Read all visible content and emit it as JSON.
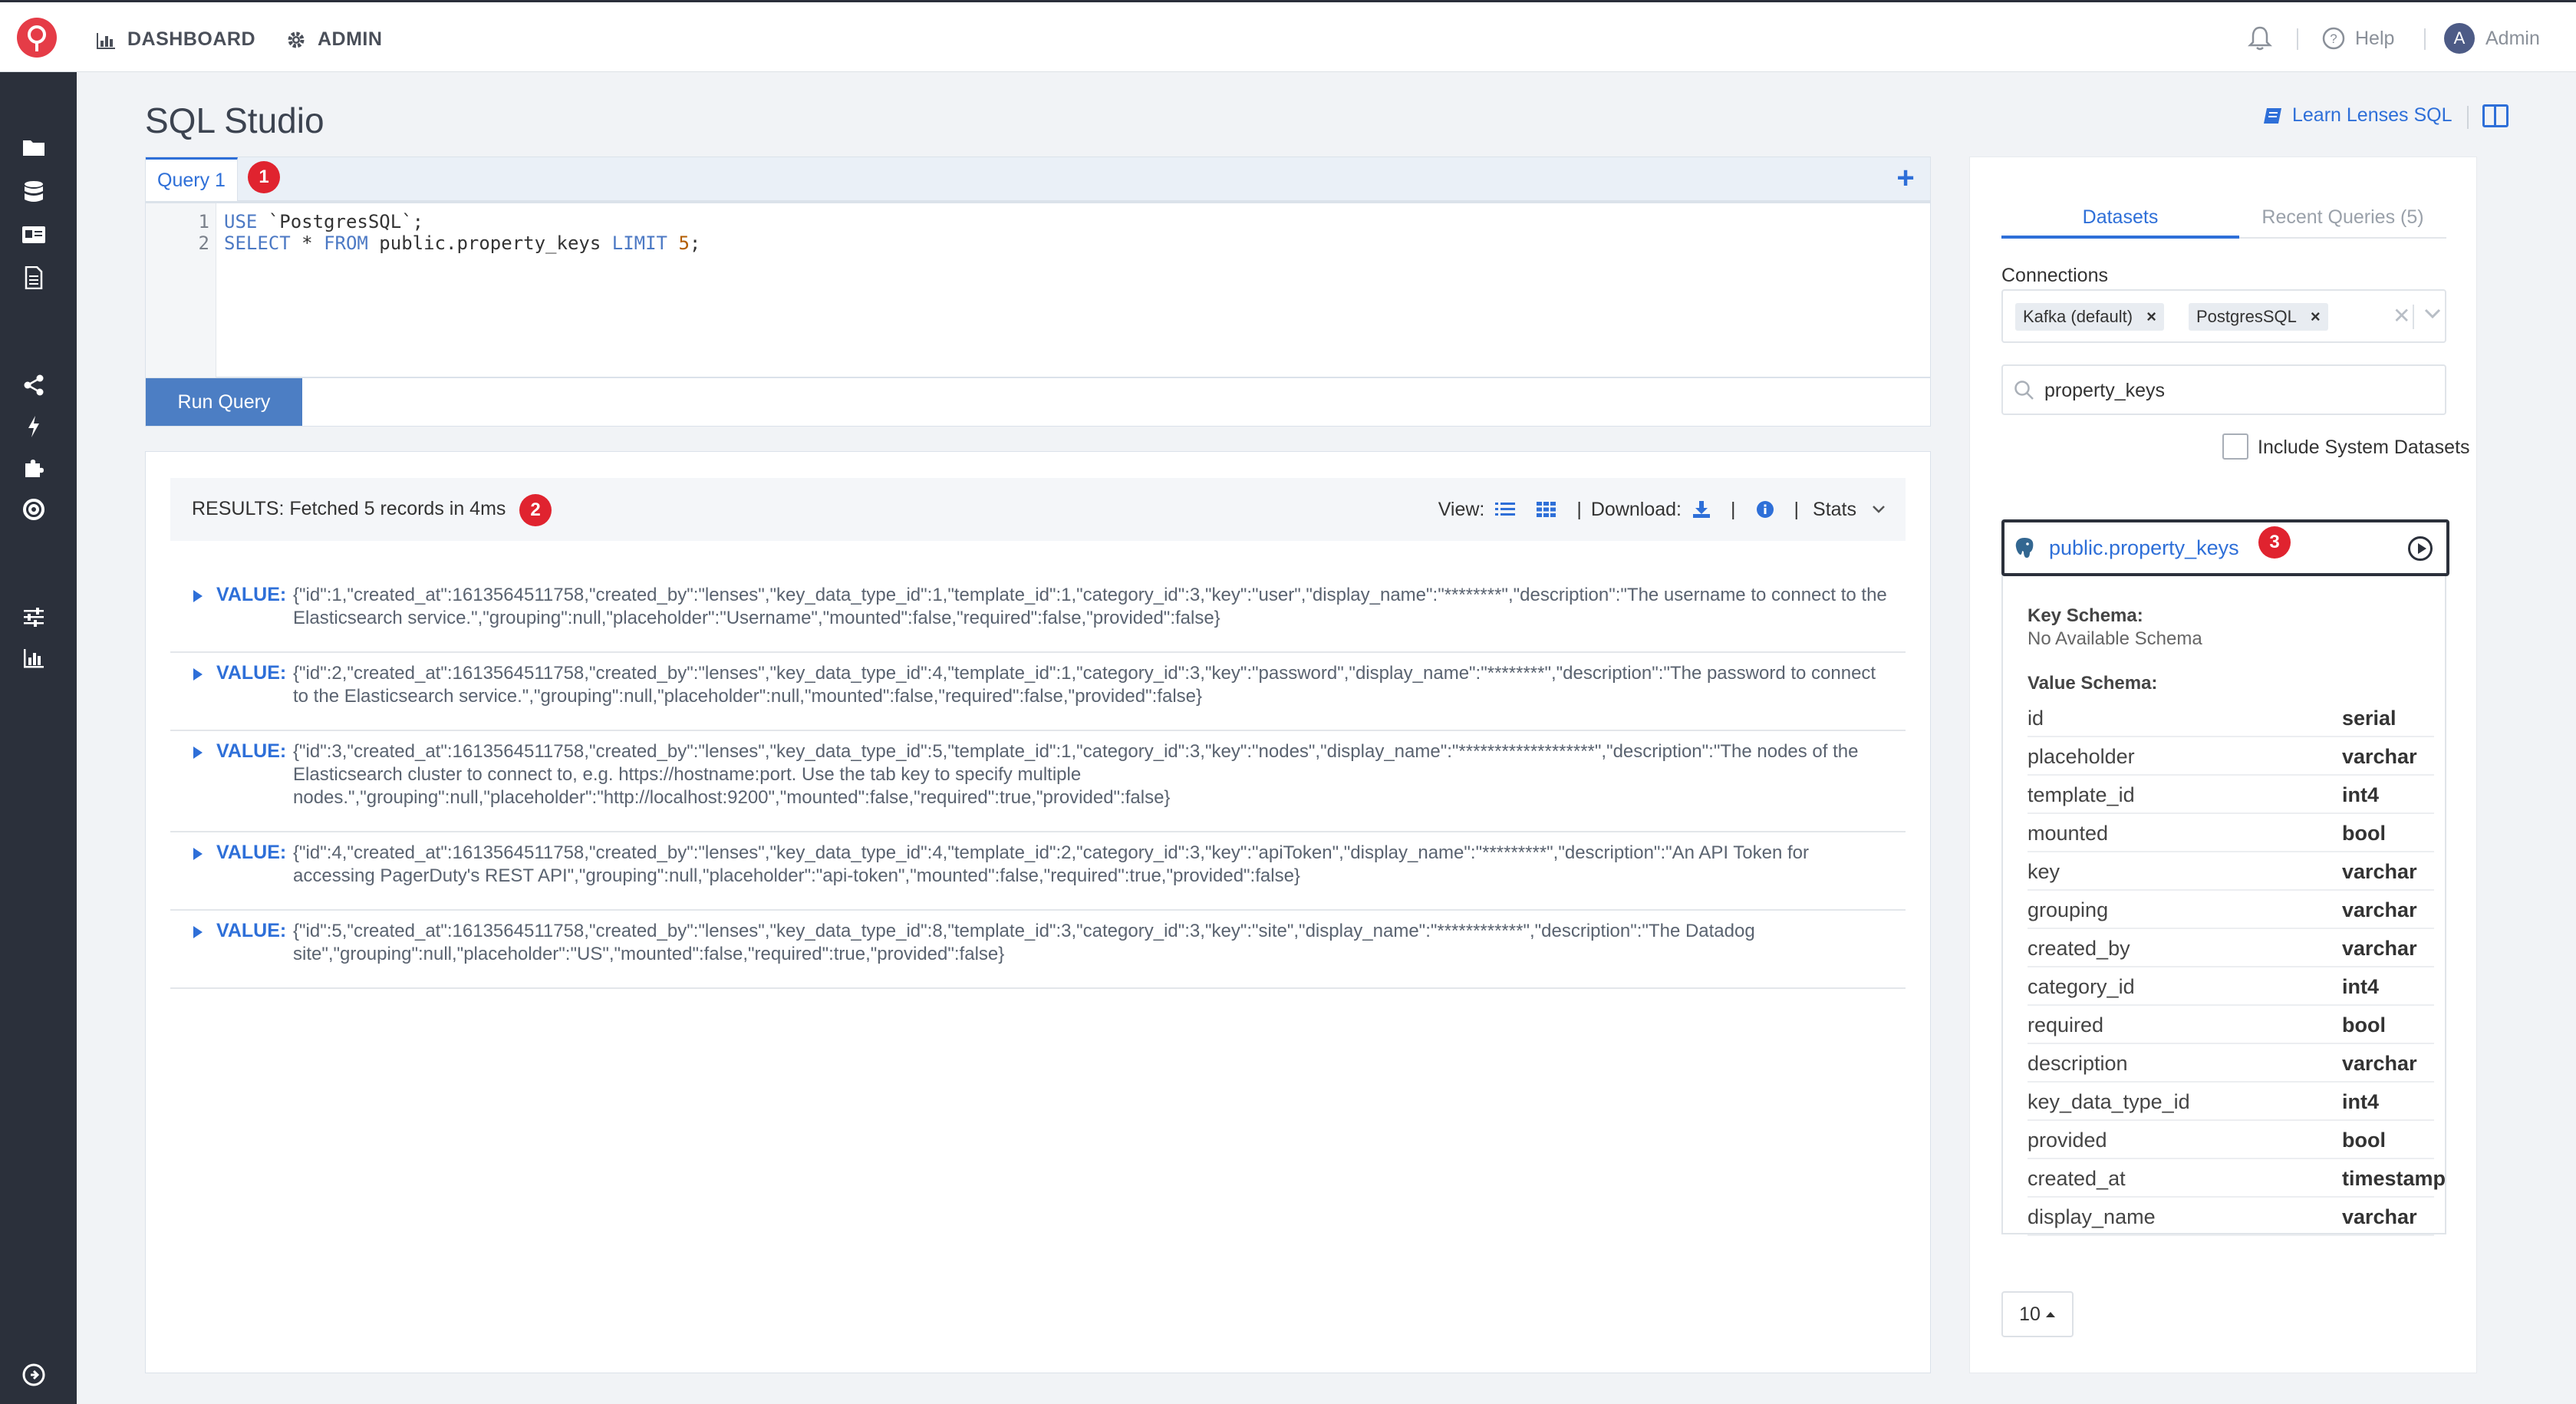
{
  "nav": {
    "dashboard": "DASHBOARD",
    "admin": "ADMIN",
    "help": "Help",
    "user_initial": "A",
    "user_name": "Admin"
  },
  "page": {
    "title": "SQL Studio",
    "learn_link": "Learn Lenses SQL"
  },
  "editor": {
    "tab_label": "Query 1",
    "tab_badge": "1",
    "line_numbers": [
      "1",
      "2"
    ],
    "run_button": "Run Query"
  },
  "results": {
    "summary": "RESULTS: Fetched 5 records in 4ms",
    "badge": "2",
    "view_label": "View:",
    "download_label": "Download:",
    "stats_label": "Stats",
    "value_label": "VALUE:",
    "rows": [
      "{\"id\":1,\"created_at\":1613564511758,\"created_by\":\"lenses\",\"key_data_type_id\":1,\"template_id\":1,\"category_id\":3,\"key\":\"user\",\"display_name\":\"********\",\"description\":\"The username to connect to the Elasticsearch service.\",\"grouping\":null,\"placeholder\":\"Username\",\"mounted\":false,\"required\":false,\"provided\":false}",
      "{\"id\":2,\"created_at\":1613564511758,\"created_by\":\"lenses\",\"key_data_type_id\":4,\"template_id\":1,\"category_id\":3,\"key\":\"password\",\"display_name\":\"********\",\"description\":\"The password to connect to the Elasticsearch service.\",\"grouping\":null,\"placeholder\":null,\"mounted\":false,\"required\":false,\"provided\":false}",
      "{\"id\":3,\"created_at\":1613564511758,\"created_by\":\"lenses\",\"key_data_type_id\":5,\"template_id\":1,\"category_id\":3,\"key\":\"nodes\",\"display_name\":\"*******************\",\"description\":\"The nodes of the Elasticsearch cluster to connect to, e.g. https://hostname:port. Use the tab key to specify multiple nodes.\",\"grouping\":null,\"placeholder\":\"http://localhost:9200\",\"mounted\":false,\"required\":true,\"provided\":false}",
      "{\"id\":4,\"created_at\":1613564511758,\"created_by\":\"lenses\",\"key_data_type_id\":4,\"template_id\":2,\"category_id\":3,\"key\":\"apiToken\",\"display_name\":\"*********\",\"description\":\"An API Token for accessing PagerDuty's REST API\",\"grouping\":null,\"placeholder\":\"api-token\",\"mounted\":false,\"required\":true,\"provided\":false}",
      "{\"id\":5,\"created_at\":1613564511758,\"created_by\":\"lenses\",\"key_data_type_id\":8,\"template_id\":3,\"category_id\":3,\"key\":\"site\",\"display_name\":\"************\",\"description\":\"The Datadog site\",\"grouping\":null,\"placeholder\":\"US\",\"mounted\":false,\"required\":true,\"provided\":false}"
    ]
  },
  "panel": {
    "tab_datasets": "Datasets",
    "tab_recent": "Recent Queries (5)",
    "connections_label": "Connections",
    "chips": [
      "Kafka (default)",
      "PostgresSQL"
    ],
    "search_value": "property_keys",
    "include_system": "Include System Datasets",
    "dataset_name": "public.property_keys",
    "dataset_badge": "3",
    "key_schema_label": "Key Schema:",
    "key_schema_value": "No Available Schema",
    "value_schema_label": "Value Schema:",
    "fields": [
      {
        "name": "id",
        "type": "serial"
      },
      {
        "name": "placeholder",
        "type": "varchar"
      },
      {
        "name": "template_id",
        "type": "int4"
      },
      {
        "name": "mounted",
        "type": "bool"
      },
      {
        "name": "key",
        "type": "varchar"
      },
      {
        "name": "grouping",
        "type": "varchar"
      },
      {
        "name": "created_by",
        "type": "varchar"
      },
      {
        "name": "category_id",
        "type": "int4"
      },
      {
        "name": "required",
        "type": "bool"
      },
      {
        "name": "description",
        "type": "varchar"
      },
      {
        "name": "key_data_type_id",
        "type": "int4"
      },
      {
        "name": "provided",
        "type": "bool"
      },
      {
        "name": "created_at",
        "type": "timestamp"
      },
      {
        "name": "display_name",
        "type": "varchar"
      }
    ],
    "page_size": "10"
  },
  "colors": {
    "accent": "#2e6fd8",
    "sidebar": "#2b303b",
    "badge": "#e0232f",
    "run_button": "#4c7ec4"
  }
}
